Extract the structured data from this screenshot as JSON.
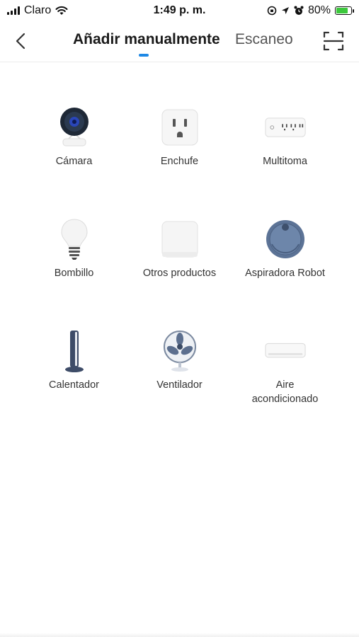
{
  "status_bar": {
    "carrier": "Claro",
    "time": "1:49 p. m.",
    "battery_percent_text": "80%",
    "battery_level": 0.8
  },
  "header": {
    "tabs": [
      {
        "label": "Añadir manualmente",
        "active": true
      },
      {
        "label": "Escaneo",
        "active": false
      }
    ],
    "accent_color": "#1e88e5"
  },
  "devices": [
    {
      "label": "Cámara",
      "icon": "camera-icon"
    },
    {
      "label": "Enchufe",
      "icon": "plug-icon"
    },
    {
      "label": "Multitoma",
      "icon": "power-strip-icon"
    },
    {
      "label": "Bombillo",
      "icon": "bulb-icon"
    },
    {
      "label": "Otros productos",
      "icon": "generic-device-icon"
    },
    {
      "label": "Aspiradora Robot",
      "icon": "robot-vacuum-icon"
    },
    {
      "label": "Calentador",
      "icon": "heater-icon"
    },
    {
      "label": "Ventilador",
      "icon": "fan-icon"
    },
    {
      "label": "Aire acondicionado",
      "icon": "air-conditioner-icon"
    }
  ]
}
